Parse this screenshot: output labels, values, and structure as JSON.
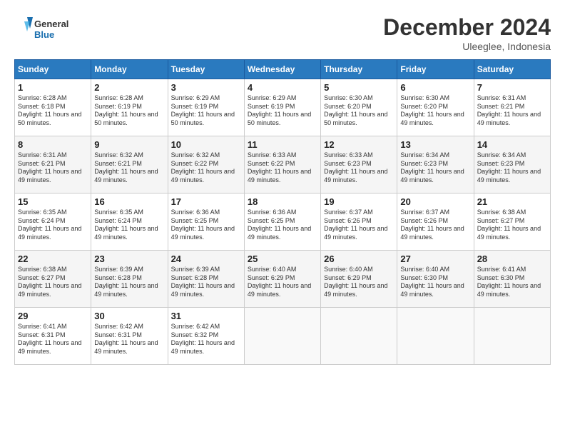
{
  "header": {
    "logo_text_general": "General",
    "logo_text_blue": "Blue",
    "month_title": "December 2024",
    "location": "Uleeglee, Indonesia"
  },
  "days_of_week": [
    "Sunday",
    "Monday",
    "Tuesday",
    "Wednesday",
    "Thursday",
    "Friday",
    "Saturday"
  ],
  "weeks": [
    [
      {
        "day": "1",
        "sunrise": "6:28 AM",
        "sunset": "6:18 PM",
        "daylight": "11 hours and 50 minutes."
      },
      {
        "day": "2",
        "sunrise": "6:28 AM",
        "sunset": "6:19 PM",
        "daylight": "11 hours and 50 minutes."
      },
      {
        "day": "3",
        "sunrise": "6:29 AM",
        "sunset": "6:19 PM",
        "daylight": "11 hours and 50 minutes."
      },
      {
        "day": "4",
        "sunrise": "6:29 AM",
        "sunset": "6:19 PM",
        "daylight": "11 hours and 50 minutes."
      },
      {
        "day": "5",
        "sunrise": "6:30 AM",
        "sunset": "6:20 PM",
        "daylight": "11 hours and 50 minutes."
      },
      {
        "day": "6",
        "sunrise": "6:30 AM",
        "sunset": "6:20 PM",
        "daylight": "11 hours and 49 minutes."
      },
      {
        "day": "7",
        "sunrise": "6:31 AM",
        "sunset": "6:21 PM",
        "daylight": "11 hours and 49 minutes."
      }
    ],
    [
      {
        "day": "8",
        "sunrise": "6:31 AM",
        "sunset": "6:21 PM",
        "daylight": "11 hours and 49 minutes."
      },
      {
        "day": "9",
        "sunrise": "6:32 AM",
        "sunset": "6:21 PM",
        "daylight": "11 hours and 49 minutes."
      },
      {
        "day": "10",
        "sunrise": "6:32 AM",
        "sunset": "6:22 PM",
        "daylight": "11 hours and 49 minutes."
      },
      {
        "day": "11",
        "sunrise": "6:33 AM",
        "sunset": "6:22 PM",
        "daylight": "11 hours and 49 minutes."
      },
      {
        "day": "12",
        "sunrise": "6:33 AM",
        "sunset": "6:23 PM",
        "daylight": "11 hours and 49 minutes."
      },
      {
        "day": "13",
        "sunrise": "6:34 AM",
        "sunset": "6:23 PM",
        "daylight": "11 hours and 49 minutes."
      },
      {
        "day": "14",
        "sunrise": "6:34 AM",
        "sunset": "6:23 PM",
        "daylight": "11 hours and 49 minutes."
      }
    ],
    [
      {
        "day": "15",
        "sunrise": "6:35 AM",
        "sunset": "6:24 PM",
        "daylight": "11 hours and 49 minutes."
      },
      {
        "day": "16",
        "sunrise": "6:35 AM",
        "sunset": "6:24 PM",
        "daylight": "11 hours and 49 minutes."
      },
      {
        "day": "17",
        "sunrise": "6:36 AM",
        "sunset": "6:25 PM",
        "daylight": "11 hours and 49 minutes."
      },
      {
        "day": "18",
        "sunrise": "6:36 AM",
        "sunset": "6:25 PM",
        "daylight": "11 hours and 49 minutes."
      },
      {
        "day": "19",
        "sunrise": "6:37 AM",
        "sunset": "6:26 PM",
        "daylight": "11 hours and 49 minutes."
      },
      {
        "day": "20",
        "sunrise": "6:37 AM",
        "sunset": "6:26 PM",
        "daylight": "11 hours and 49 minutes."
      },
      {
        "day": "21",
        "sunrise": "6:38 AM",
        "sunset": "6:27 PM",
        "daylight": "11 hours and 49 minutes."
      }
    ],
    [
      {
        "day": "22",
        "sunrise": "6:38 AM",
        "sunset": "6:27 PM",
        "daylight": "11 hours and 49 minutes."
      },
      {
        "day": "23",
        "sunrise": "6:39 AM",
        "sunset": "6:28 PM",
        "daylight": "11 hours and 49 minutes."
      },
      {
        "day": "24",
        "sunrise": "6:39 AM",
        "sunset": "6:28 PM",
        "daylight": "11 hours and 49 minutes."
      },
      {
        "day": "25",
        "sunrise": "6:40 AM",
        "sunset": "6:29 PM",
        "daylight": "11 hours and 49 minutes."
      },
      {
        "day": "26",
        "sunrise": "6:40 AM",
        "sunset": "6:29 PM",
        "daylight": "11 hours and 49 minutes."
      },
      {
        "day": "27",
        "sunrise": "6:40 AM",
        "sunset": "6:30 PM",
        "daylight": "11 hours and 49 minutes."
      },
      {
        "day": "28",
        "sunrise": "6:41 AM",
        "sunset": "6:30 PM",
        "daylight": "11 hours and 49 minutes."
      }
    ],
    [
      {
        "day": "29",
        "sunrise": "6:41 AM",
        "sunset": "6:31 PM",
        "daylight": "11 hours and 49 minutes."
      },
      {
        "day": "30",
        "sunrise": "6:42 AM",
        "sunset": "6:31 PM",
        "daylight": "11 hours and 49 minutes."
      },
      {
        "day": "31",
        "sunrise": "6:42 AM",
        "sunset": "6:32 PM",
        "daylight": "11 hours and 49 minutes."
      },
      null,
      null,
      null,
      null
    ]
  ]
}
